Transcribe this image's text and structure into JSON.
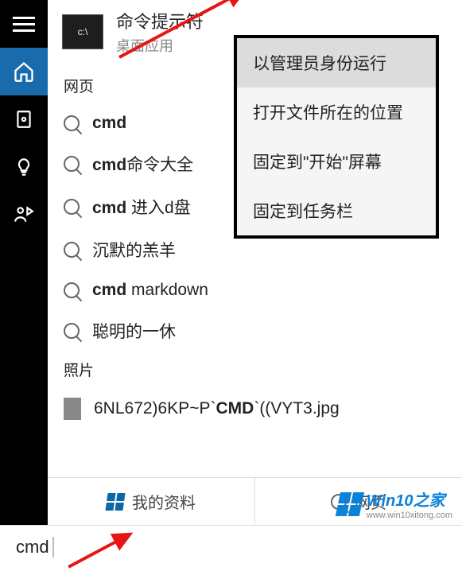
{
  "best_match": {
    "icon_text": "c:\\",
    "title": "命令提示符",
    "subtitle": "桌面应用"
  },
  "sections": {
    "web_label": "网页",
    "photos_label": "照片"
  },
  "web_results": [
    {
      "prefix": "cmd",
      "rest": ""
    },
    {
      "prefix": "cmd",
      "rest": "命令大全"
    },
    {
      "prefix": "cmd",
      "rest": " 进入d盘"
    },
    {
      "prefix": "",
      "rest": "沉默的羔羊"
    },
    {
      "prefix": "cmd",
      "rest": " markdown"
    },
    {
      "prefix": "",
      "rest": "聪明的一休"
    }
  ],
  "photo_result": {
    "pre": "6NL672)6KP~P`",
    "bold": "CMD",
    "post": "`((VYT3.jpg"
  },
  "context_menu": [
    "以管理员身份运行",
    "打开文件所在的位置",
    "固定到\"开始\"屏幕",
    "固定到任务栏"
  ],
  "tabs": {
    "my_stuff": "我的资料",
    "web": "网页"
  },
  "search_value": "cmd",
  "watermark": {
    "title": "Win10之家",
    "url": "www.win10xitong.com"
  }
}
